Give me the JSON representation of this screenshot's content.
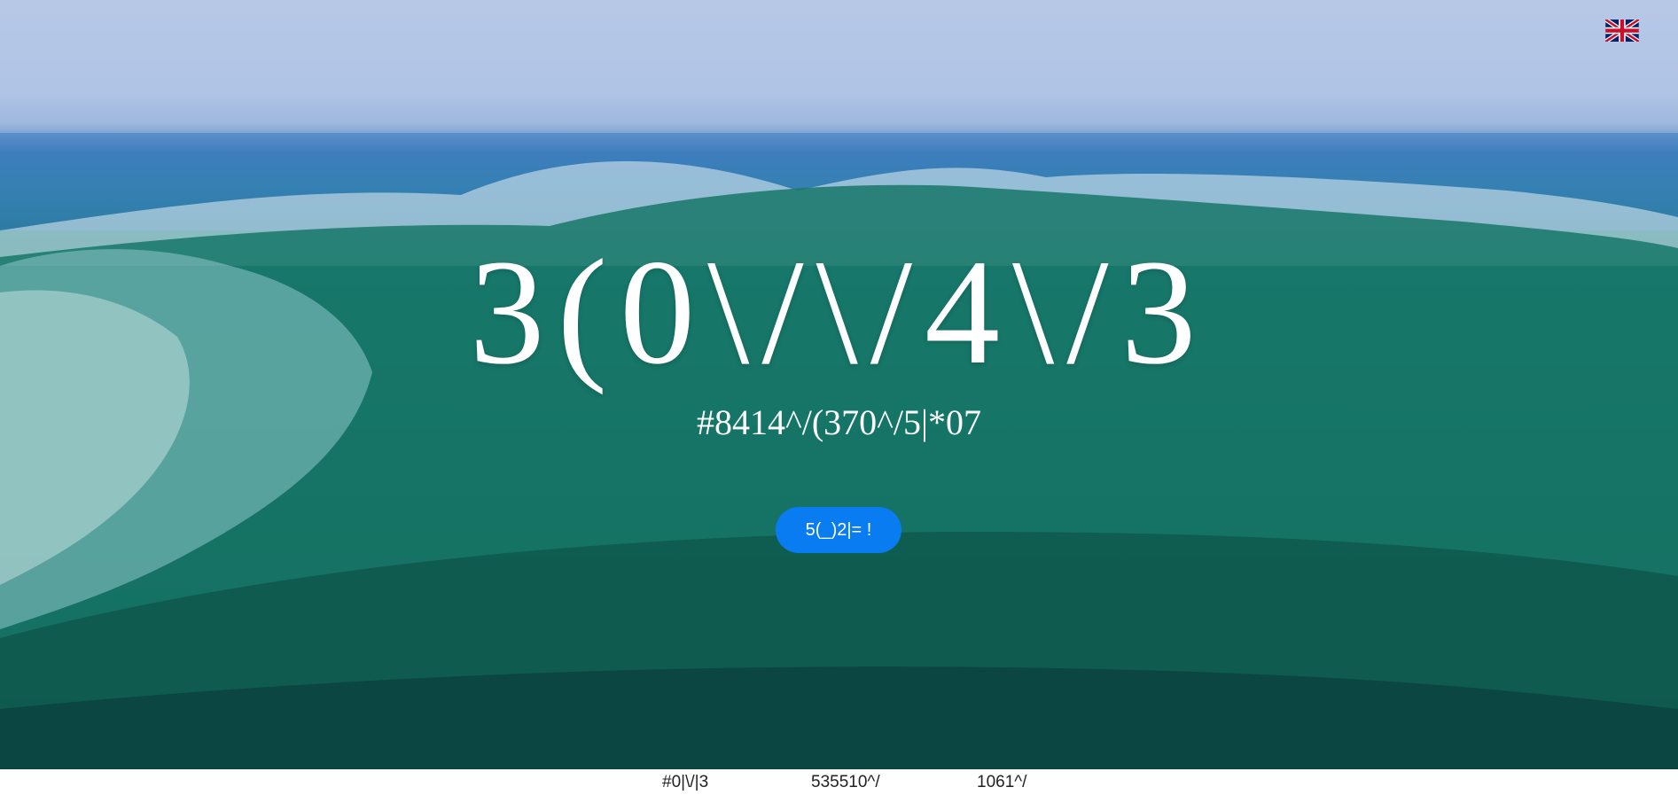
{
  "hero": {
    "title": "3(0\\/\\/4\\/3",
    "subtitle": "#8414^/(370^/5|*07",
    "cta_label": "5(_)2|= !"
  },
  "language": {
    "icon": "uk-flag-icon"
  },
  "footer": {
    "links": [
      {
        "label": "#0|\\/|3"
      },
      {
        "label": "535510^/"
      },
      {
        "label": "1061^/"
      }
    ]
  },
  "colors": {
    "accent": "#0a7cf2",
    "text_light": "#ffffff",
    "footer_text": "#222222"
  }
}
